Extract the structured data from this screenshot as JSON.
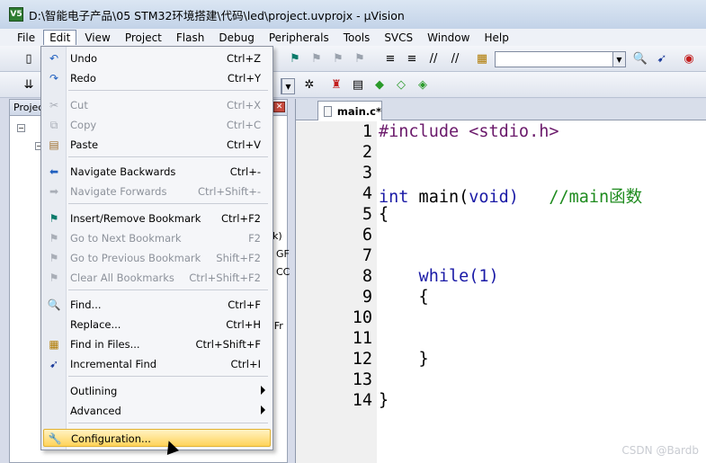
{
  "window": {
    "title": "D:\\智能电子产品\\05 STM32环境搭建\\代码\\led\\project.uvprojx - µVision",
    "icon_label": "V5"
  },
  "menubar": {
    "items": [
      "File",
      "Edit",
      "View",
      "Project",
      "Flash",
      "Debug",
      "Peripherals",
      "Tools",
      "SVCS",
      "Window",
      "Help"
    ],
    "active": "Edit"
  },
  "project_pane": {
    "title": "Projec",
    "fragments": [
      "k)",
      "GF",
      "CC",
      ":Fr"
    ]
  },
  "editor": {
    "tab_label": "main.c*",
    "lines": [
      {
        "num": "1",
        "text": "#include <stdio.h>"
      },
      {
        "num": "2",
        "text": ""
      },
      {
        "num": "3",
        "text": ""
      },
      {
        "num": "4",
        "text": "int main(void)   //main函数"
      },
      {
        "num": "5",
        "text": "{"
      },
      {
        "num": "6",
        "text": ""
      },
      {
        "num": "7",
        "text": ""
      },
      {
        "num": "8",
        "text": "    while(1)"
      },
      {
        "num": "9",
        "text": "    {"
      },
      {
        "num": "10",
        "text": ""
      },
      {
        "num": "11",
        "text": ""
      },
      {
        "num": "12",
        "text": "    }"
      },
      {
        "num": "13",
        "text": ""
      },
      {
        "num": "14",
        "text": "}"
      }
    ]
  },
  "edit_menu": {
    "items": [
      {
        "label": "Undo",
        "shortcut": "Ctrl+Z",
        "icon": "undo-icon",
        "enabled": true
      },
      {
        "label": "Redo",
        "shortcut": "Ctrl+Y",
        "icon": "redo-icon",
        "enabled": true
      },
      {
        "label": "Cut",
        "shortcut": "Ctrl+X",
        "icon": "cut-icon",
        "enabled": false
      },
      {
        "label": "Copy",
        "shortcut": "Ctrl+C",
        "icon": "copy-icon",
        "enabled": false
      },
      {
        "label": "Paste",
        "shortcut": "Ctrl+V",
        "icon": "paste-icon",
        "enabled": true
      },
      {
        "label": "Navigate Backwards",
        "shortcut": "Ctrl+-",
        "icon": "arrow-left-icon",
        "enabled": true
      },
      {
        "label": "Navigate Forwards",
        "shortcut": "Ctrl+Shift+-",
        "icon": "arrow-right-icon",
        "enabled": false
      },
      {
        "label": "Insert/Remove Bookmark",
        "shortcut": "Ctrl+F2",
        "icon": "bookmark-icon",
        "enabled": true
      },
      {
        "label": "Go to Next Bookmark",
        "shortcut": "F2",
        "icon": "next-bookmark-icon",
        "enabled": false
      },
      {
        "label": "Go to Previous Bookmark",
        "shortcut": "Shift+F2",
        "icon": "prev-bookmark-icon",
        "enabled": false
      },
      {
        "label": "Clear All Bookmarks",
        "shortcut": "Ctrl+Shift+F2",
        "icon": "clear-bookmarks-icon",
        "enabled": false
      },
      {
        "label": "Find...",
        "shortcut": "Ctrl+F",
        "icon": "find-icon",
        "enabled": true
      },
      {
        "label": "Replace...",
        "shortcut": "Ctrl+H",
        "icon": "",
        "enabled": true
      },
      {
        "label": "Find in Files...",
        "shortcut": "Ctrl+Shift+F",
        "icon": "find-in-files-icon",
        "enabled": true
      },
      {
        "label": "Incremental Find",
        "shortcut": "Ctrl+I",
        "icon": "incremental-find-icon",
        "enabled": true
      },
      {
        "label": "Outlining",
        "shortcut": "",
        "icon": "",
        "enabled": true,
        "submenu": true
      },
      {
        "label": "Advanced",
        "shortcut": "",
        "icon": "",
        "enabled": true,
        "submenu": true
      },
      {
        "label": "Configuration...",
        "shortcut": "",
        "icon": "wrench-icon",
        "enabled": true,
        "highlighted": true
      }
    ]
  },
  "watermark": "CSDN @Bardb",
  "colors": {
    "keyword": "#1a1aa6",
    "comment": "#1e8b1e",
    "highlight": "#ffd35a"
  }
}
